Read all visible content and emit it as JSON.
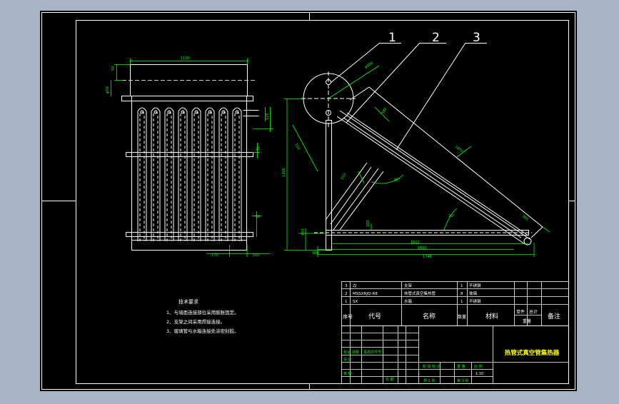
{
  "drawing": {
    "colors": {
      "app_background": "#a9b3c6",
      "sheet": "#000000",
      "frame": "#ffffff",
      "geometry": "#ffffff",
      "dimension": "#00ff00",
      "tag": "#ffff00"
    },
    "callouts": [
      "1",
      "2",
      "3"
    ],
    "front_view": {
      "overall_width": "1110",
      "left_dims": [
        "50",
        "φ50"
      ],
      "right_dims": [
        "125",
        "25",
        "50"
      ],
      "bottom_dims": [
        "170",
        "100"
      ]
    },
    "side_view": {
      "dims": {
        "circle": "φ480",
        "diag_a": "580",
        "diag_b": "1870",
        "diag_c": "553",
        "diag_d": "150",
        "height": "1300",
        "small": "100",
        "base_inner": "1612",
        "base_mid": "1600",
        "base_outer": "1748",
        "right_end": "380",
        "angle_a": "90°",
        "angle_b": "30°"
      }
    },
    "tech_notes": {
      "title": "技术要求",
      "items": [
        "1、与墙面连接部位采用膨胀固定。",
        "2、支架之间采用焊接连接。",
        "3、玻璃管与水箱连接处涂密封胶。"
      ]
    },
    "bom": {
      "rows": [
        {
          "no": "3",
          "code": "ZJ",
          "name": "支架",
          "qty": "1",
          "material": "不锈钢"
        },
        {
          "no": "2",
          "code": "MSSXRJQ-R8",
          "name": "热管式真空集热管",
          "qty": "8",
          "material": "玻璃"
        },
        {
          "no": "1",
          "code": "SX",
          "name": "水箱",
          "qty": "1",
          "material": "不锈钢"
        }
      ],
      "header": {
        "no": "序号",
        "code": "代号",
        "name": "名称",
        "qty": "数量",
        "material": "材料",
        "single": "单件",
        "total": "总计",
        "weight": "重量",
        "remark": "备注"
      }
    },
    "title_block": {
      "drawing_title": "热管式真空管集热器",
      "row_a": [
        "标记",
        "处数",
        "更改文件号"
      ],
      "row_b": "设 计",
      "review": "审 核",
      "stage": "阶 段 标 记",
      "weight": "重 量",
      "scale": "比 例",
      "scale_value": "1:10",
      "sheet_total": "共 1 张",
      "sheet_no": "第 1 张",
      "date": "日 期"
    }
  }
}
